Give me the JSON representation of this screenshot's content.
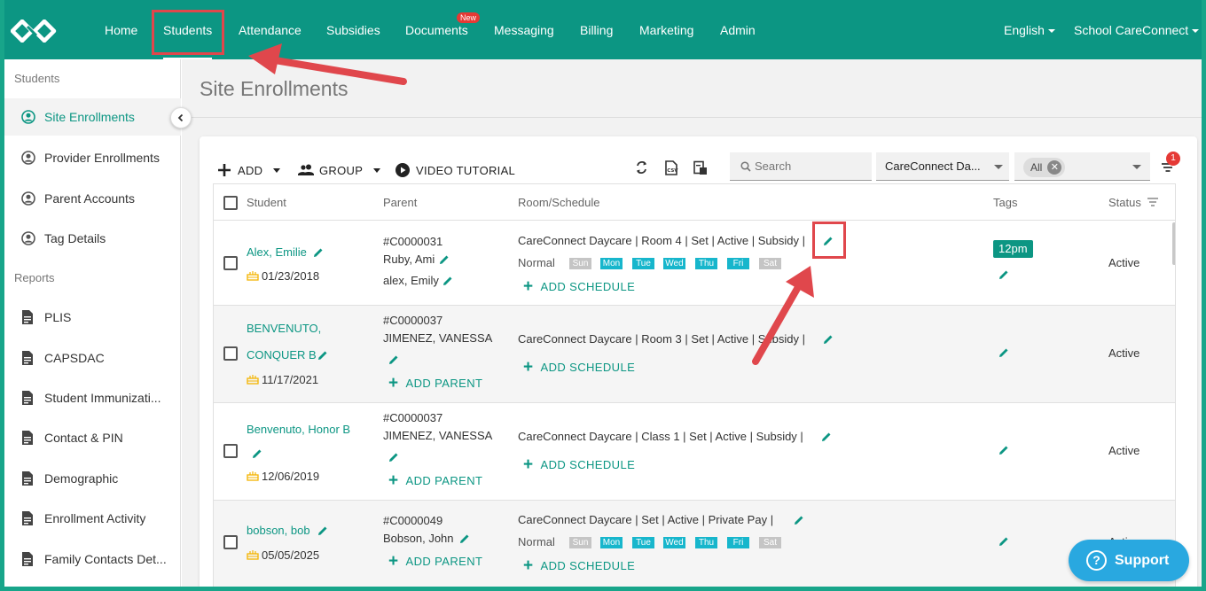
{
  "nav": {
    "items": [
      "Home",
      "Students",
      "Attendance",
      "Subsidies",
      "Documents",
      "Messaging",
      "Billing",
      "Marketing",
      "Admin"
    ],
    "documents_badge": "New",
    "language": "English",
    "account": "School CareConnect"
  },
  "sidebar": {
    "section_students": "Students",
    "students_items": [
      "Site Enrollments",
      "Provider Enrollments",
      "Parent Accounts",
      "Tag Details"
    ],
    "section_reports": "Reports",
    "reports_items": [
      "PLIS",
      "CAPSDAC",
      "Student Immunizati...",
      "Contact & PIN",
      "Demographic",
      "Enrollment Activity",
      "Family Contacts Det..."
    ]
  },
  "page": {
    "title": "Site Enrollments"
  },
  "toolbar": {
    "add": "ADD",
    "group": "GROUP",
    "video_tutorial": "VIDEO TUTORIAL",
    "search_placeholder": "Search",
    "site_select": "CareConnect Da...",
    "status_chip": "All",
    "filter_badge": "1"
  },
  "table": {
    "headers": {
      "student": "Student",
      "parent": "Parent",
      "room": "Room/Schedule",
      "tags": "Tags",
      "status": "Status"
    },
    "add_schedule": "ADD SCHEDULE",
    "add_parent": "ADD PARENT",
    "days": [
      "Sun",
      "Mon",
      "Tue",
      "Wed",
      "Thu",
      "Fri",
      "Sat"
    ],
    "rows": [
      {
        "name": "Alex, Emilie",
        "dob": "01/23/2018",
        "account": "#C0000031",
        "parents": [
          "Ruby, Ami",
          "alex, Emily"
        ],
        "room": "CareConnect Daycare |  Room 4 |  Set   | Active |  Subsidy   |",
        "schedule_type": "Normal",
        "tag": "12pm",
        "status": "Active"
      },
      {
        "name1": "BENVENUTO,",
        "name2": "CONQUER B",
        "dob": "11/17/2021",
        "account": "#C0000037",
        "parents": [
          "JIMENEZ, VANESSA"
        ],
        "room": "CareConnect Daycare |  Room 3 |  Set   | Active |  Subsidy   |",
        "status": "Active"
      },
      {
        "name": "Benvenuto, Honor B",
        "dob": "12/06/2019",
        "account": "#C0000037",
        "parents": [
          "JIMENEZ, VANESSA"
        ],
        "room": "CareConnect Daycare |  Class 1 |  Set   | Active |  Subsidy   |",
        "status": "Active"
      },
      {
        "name": "bobson, bob",
        "dob": "05/05/2025",
        "account": "#C0000049",
        "parents": [
          "Bobson, John"
        ],
        "room": "CareConnect Daycare |    Set   | Active |  Private Pay   |",
        "schedule_type": "Normal",
        "status": "Active"
      }
    ]
  },
  "support": {
    "label": "Support"
  },
  "colors": {
    "brand": "#0c9683",
    "annotation": "#e0474c",
    "day_on": "#17b6cc",
    "day_off": "#c5c5c5",
    "support": "#29a8e0",
    "badge": "#e53935"
  }
}
